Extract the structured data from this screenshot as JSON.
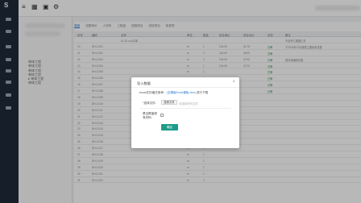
{
  "app": {
    "logo": "S"
  },
  "tree": [
    "单体工程",
    "单体工程",
    "单体工程",
    "单体工程",
    "▸ 单体工程",
    "单体工程"
  ],
  "tabs": [
    "清单",
    "定额单价",
    "人材机",
    "工程量",
    "措施项目",
    "其他项目",
    "取费表"
  ],
  "table_headers": [
    "序号",
    "编码",
    "名称",
    "单位",
    "数量",
    "综合单价",
    "综合合价",
    "状态",
    "备注"
  ],
  "rows": [
    {
      "no": "",
      "code": "",
      "name": "01.10.x.xx清单",
      "unit": "",
      "qty": "",
      "price": "",
      "total": "",
      "status": "",
      "note": "不含甲乙数据汇总"
    },
    {
      "no": "10",
      "code": "DH-2-001",
      "name": "",
      "unit": "m",
      "qty": "1",
      "price": "104.00",
      "total": "51.75",
      "status": "已审",
      "note": "于2019年12月原施工图纸未变更"
    },
    {
      "no": "11",
      "code": "DH-2-002",
      "name": "",
      "unit": "m",
      "qty": "1",
      "price": "104.00",
      "total": "49.00",
      "status": "已审",
      "note": ""
    },
    {
      "no": "12",
      "code": "DH-2-003",
      "name": "",
      "unit": "m",
      "qty": "1",
      "price": "104.00",
      "total": "47.00",
      "status": "已审",
      "note": "按清单编码归属"
    },
    {
      "no": "13",
      "code": "DH-2-004",
      "name": "",
      "unit": "m",
      "qty": "1",
      "price": "104.00",
      "total": "47.00",
      "status": "已审",
      "note": ""
    },
    {
      "no": "14",
      "code": "DH-2-005",
      "name": "",
      "unit": "m",
      "qty": "1",
      "price": "",
      "total": "",
      "status": "已审",
      "note": ""
    },
    {
      "no": "15",
      "code": "DH-2-006",
      "name": "",
      "unit": "m",
      "qty": "1",
      "price": "",
      "total": "",
      "status": "已审",
      "note": ""
    },
    {
      "no": "16",
      "code": "DH-2-007",
      "name": "",
      "unit": "m",
      "qty": "1",
      "price": "",
      "total": "",
      "status": "已审",
      "note": ""
    },
    {
      "no": "17",
      "code": "DH-2-008",
      "name": "",
      "unit": "m",
      "qty": "1",
      "price": "",
      "total": "",
      "status": "已审",
      "note": ""
    },
    {
      "no": "18",
      "code": "DH-2-009",
      "name": "",
      "unit": "m",
      "qty": "1",
      "price": "",
      "total": "",
      "status": "",
      "note": ""
    },
    {
      "no": "19",
      "code": "DH-2-010",
      "name": "",
      "unit": "m",
      "qty": "1",
      "price": "",
      "total": "",
      "status": "",
      "note": ""
    },
    {
      "no": "20",
      "code": "DH-2-011",
      "name": "",
      "unit": "m",
      "qty": "1",
      "price": "",
      "total": "",
      "status": "",
      "note": ""
    },
    {
      "no": "21",
      "code": "DH-2-012",
      "name": "",
      "unit": "m",
      "qty": "1",
      "price": "",
      "total": "",
      "status": "",
      "note": ""
    },
    {
      "no": "22",
      "code": "DH-2-013",
      "name": "",
      "unit": "m",
      "qty": "1",
      "price": "",
      "total": "",
      "status": "",
      "note": ""
    },
    {
      "no": "23",
      "code": "DH-2-014",
      "name": "",
      "unit": "m",
      "qty": "1",
      "price": "",
      "total": "",
      "status": "",
      "note": ""
    },
    {
      "no": "24",
      "code": "DH-2-015",
      "name": "",
      "unit": "m",
      "qty": "1",
      "price": "",
      "total": "",
      "status": "",
      "note": ""
    },
    {
      "no": "25",
      "code": "DH-2-016",
      "name": "",
      "unit": "m",
      "qty": "1",
      "price": "",
      "total": "",
      "status": "",
      "note": ""
    },
    {
      "no": "26",
      "code": "DH-2-017",
      "name": "",
      "unit": "m",
      "qty": "1",
      "price": "",
      "total": "",
      "status": "",
      "note": ""
    },
    {
      "no": "27",
      "code": "DH-2-018",
      "name": "",
      "unit": "m",
      "qty": "1",
      "price": "",
      "total": "",
      "status": "",
      "note": ""
    },
    {
      "no": "28",
      "code": "DH-2-019",
      "name": "",
      "unit": "m",
      "qty": "1",
      "price": "",
      "total": "",
      "status": "",
      "note": ""
    },
    {
      "no": "29",
      "code": "DH-2-020",
      "name": "",
      "unit": "m",
      "qty": "1",
      "price": "",
      "total": "",
      "status": "",
      "note": ""
    },
    {
      "no": "30",
      "code": "DH-2-021",
      "name": "",
      "unit": "m",
      "qty": "1",
      "price": "",
      "total": "",
      "status": "",
      "note": ""
    },
    {
      "no": "31",
      "code": "DH-2-022",
      "name": "",
      "unit": "m",
      "qty": "1",
      "price": "",
      "total": "",
      "status": "",
      "note": ""
    }
  ],
  "modal": {
    "title": "导入数据",
    "close": "×",
    "download_prefix": "excel文件格式参考：",
    "download_link": "(空模版Excel模板.xlsx)",
    "download_suffix": " 进行下载",
    "file_required": "*",
    "file_label": "选择文件:",
    "file_button": "选择文件",
    "file_placeholder": "未选择任何文件",
    "overwrite_label_1": "是否覆盖原",
    "overwrite_label_2": "有材料:",
    "confirm": "确定"
  },
  "colors": {
    "primary": "#1e9c8a",
    "link": "#2f7dcf",
    "sidebar": "#1f2b3a"
  }
}
